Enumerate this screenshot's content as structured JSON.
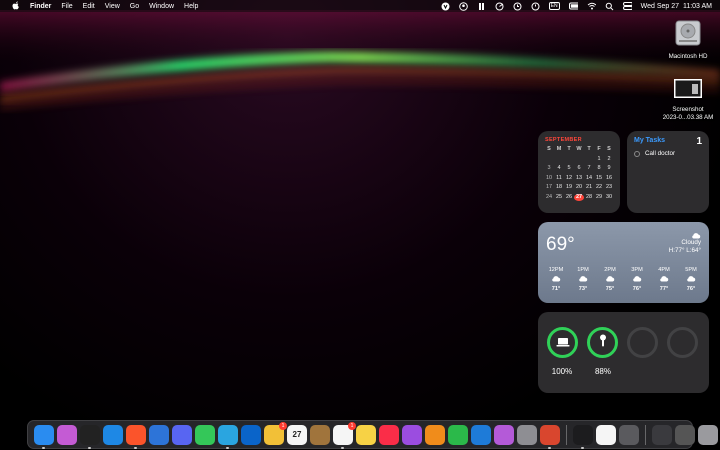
{
  "menubar": {
    "app_name": "Finder",
    "menus": [
      "File",
      "Edit",
      "View",
      "Go",
      "Window",
      "Help"
    ],
    "datetime": "Wed Sep 27  11:03 AM",
    "status_icons": [
      "vpn-icon",
      "user-icon",
      "brush-icon",
      "radar-icon",
      "time-machine-icon",
      "sleep-icon",
      "keyboard-input-icon",
      "battery-icon",
      "wifi-icon",
      "search-icon",
      "control-center-icon"
    ],
    "input_label": "EN"
  },
  "desktop": {
    "items": [
      {
        "label": "Macintosh HD",
        "icon": "hard-drive-icon"
      },
      {
        "label": "Screenshot\n2023-0...03.38 AM",
        "icon": "screenshot-file-icon"
      }
    ]
  },
  "calendar": {
    "month": "SEPTEMBER",
    "weekdays": [
      "S",
      "M",
      "T",
      "W",
      "T",
      "F",
      "S"
    ],
    "today": "27",
    "weeks": [
      [
        "",
        "",
        "",
        "",
        "",
        "1",
        "2"
      ],
      [
        "3",
        "4",
        "5",
        "6",
        "7",
        "8",
        "9"
      ],
      [
        "10",
        "11",
        "12",
        "13",
        "14",
        "15",
        "16"
      ],
      [
        "17",
        "18",
        "19",
        "20",
        "21",
        "22",
        "23"
      ],
      [
        "24",
        "25",
        "26",
        "27",
        "28",
        "29",
        "30"
      ]
    ]
  },
  "tasks": {
    "title": "My Tasks",
    "count": "1",
    "items": [
      "Call doctor"
    ]
  },
  "weather": {
    "temp": "69°",
    "condition": "Cloudy",
    "hilo": "H:77° L:64°",
    "hours": [
      {
        "time": "12PM",
        "temp": "71°"
      },
      {
        "time": "1PM",
        "temp": "73°"
      },
      {
        "time": "2PM",
        "temp": "75°"
      },
      {
        "time": "3PM",
        "temp": "76°"
      },
      {
        "time": "4PM",
        "temp": "77°"
      },
      {
        "time": "5PM",
        "temp": "76°"
      }
    ]
  },
  "batteries": {
    "devices": [
      {
        "icon": "laptop-icon",
        "percent": "100%",
        "level": 1.0
      },
      {
        "icon": "airpod-icon",
        "percent": "88%",
        "level": 0.88
      },
      {
        "icon": "empty-slot",
        "percent": "",
        "level": 0
      },
      {
        "icon": "empty-slot",
        "percent": "",
        "level": 0
      }
    ]
  },
  "dock": {
    "apps": [
      {
        "name": "finder-icon",
        "color": "#2a8cf0",
        "running": true
      },
      {
        "name": "launchpad-icon",
        "color": "#c45bd4",
        "running": false
      },
      {
        "name": "terminal-icon",
        "color": "#222222",
        "running": true
      },
      {
        "name": "safari-icon",
        "color": "#1e88e5",
        "running": false
      },
      {
        "name": "brave-icon",
        "color": "#fb542b",
        "running": true
      },
      {
        "name": "sandbox-icon",
        "color": "#2d74d8",
        "running": false
      },
      {
        "name": "discord-icon",
        "color": "#5865f2",
        "running": false
      },
      {
        "name": "messages-icon",
        "color": "#34c759",
        "running": false
      },
      {
        "name": "telegram-icon",
        "color": "#2aa5e0",
        "running": true
      },
      {
        "name": "outlook-icon",
        "color": "#0a64c9",
        "running": false
      },
      {
        "name": "photos-icon",
        "color": "#f2c037",
        "running": false,
        "badge": "1"
      },
      {
        "name": "calendar-app-icon",
        "color": "#f5f5f5",
        "running": false,
        "text": "27"
      },
      {
        "name": "archive-icon",
        "color": "#a0743c",
        "running": false
      },
      {
        "name": "reminders-icon",
        "color": "#f5f5f5",
        "running": true,
        "badge": "1"
      },
      {
        "name": "notes-icon",
        "color": "#f7d245",
        "running": false
      },
      {
        "name": "music-icon",
        "color": "#fa2d48",
        "running": false
      },
      {
        "name": "podcasts-icon",
        "color": "#9b4de0",
        "running": false
      },
      {
        "name": "pages-icon",
        "color": "#f08c1b",
        "running": false
      },
      {
        "name": "numbers-icon",
        "color": "#2bb94a",
        "running": false
      },
      {
        "name": "keynote-icon",
        "color": "#1e7bd8",
        "running": false
      },
      {
        "name": "flower-app-icon",
        "color": "#b45ad8",
        "running": false
      },
      {
        "name": "system-settings-icon",
        "color": "#8e8e93",
        "running": false
      },
      {
        "name": "remote-desktop-icon",
        "color": "#d9462e",
        "running": true
      }
    ],
    "utilities": [
      {
        "name": "activity-monitor-icon",
        "color": "#1c1c1e",
        "running": true
      },
      {
        "name": "clock-icon",
        "color": "#f5f5f5",
        "running": false
      },
      {
        "name": "calculator-icon",
        "color": "#5a5a5e",
        "running": false
      }
    ],
    "recent": [
      {
        "name": "recent-screenshot-icon",
        "color": "#3a3a3e"
      },
      {
        "name": "downloads-stack-icon",
        "color": "#555"
      },
      {
        "name": "trash-icon",
        "color": "#9a9a9e"
      }
    ]
  }
}
